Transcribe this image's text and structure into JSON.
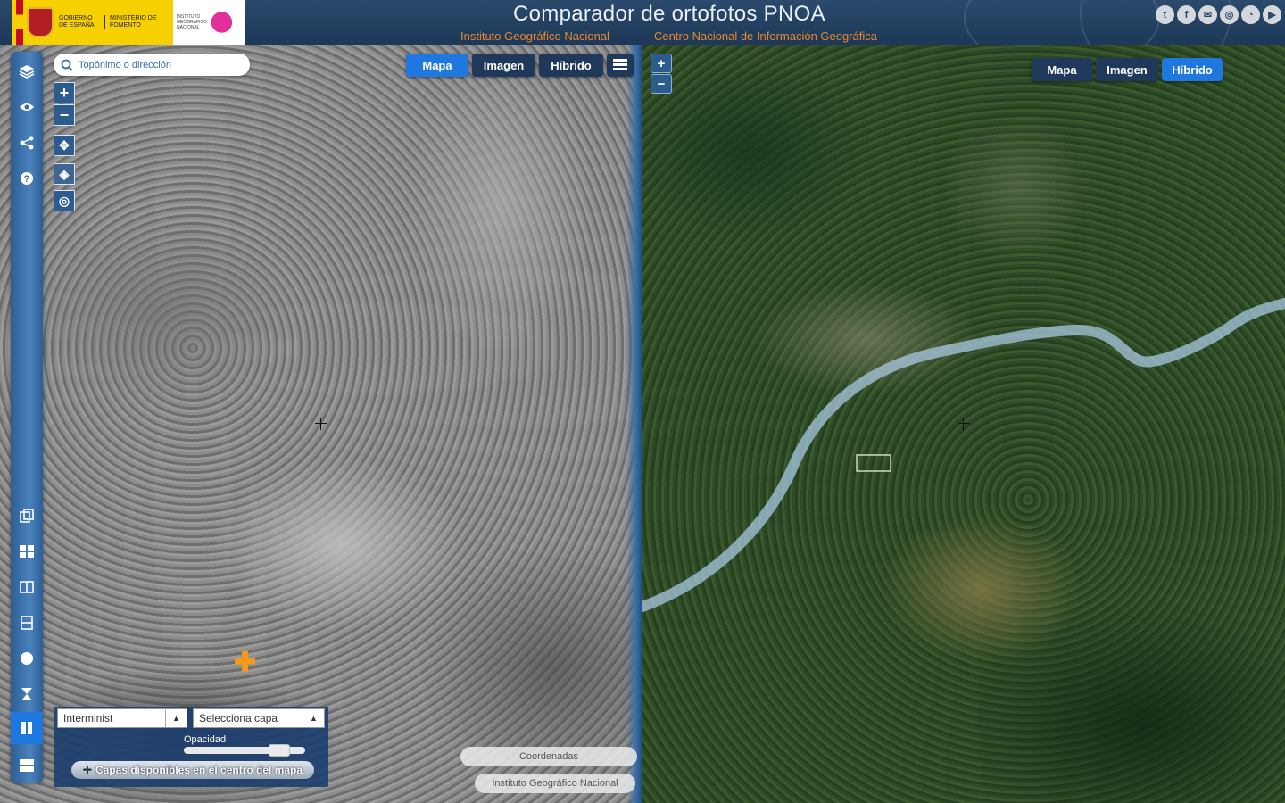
{
  "header": {
    "title": "Comparador de ortofotos PNOA",
    "subtitle_left": "Instituto Geográfico Nacional",
    "subtitle_right": "Centro Nacional de Información Geográfica",
    "logo_gov_text": "GOBIERNO DE ESPAÑA",
    "logo_ministry_text": "MINISTERIO DE FOMENTO",
    "logo_ign_text": "INSTITUTO GEOGRÁFICO NACIONAL",
    "social": [
      {
        "name": "twitter-icon",
        "glyph": "t"
      },
      {
        "name": "facebook-icon",
        "glyph": "f"
      },
      {
        "name": "email-icon",
        "glyph": "✉"
      },
      {
        "name": "instagram-icon",
        "glyph": "◎"
      },
      {
        "name": "rss-icon",
        "glyph": "◔"
      },
      {
        "name": "youtube-icon",
        "glyph": "▶"
      }
    ]
  },
  "colors": {
    "header_bg": "#2b4a6c",
    "accent_orange": "#e8892b",
    "active_blue": "#1f78e0",
    "button_dark": "#20395b"
  },
  "search": {
    "placeholder": "Topónimo o dirección"
  },
  "left_map": {
    "layer_buttons": {
      "map": "Mapa",
      "image": "Imagen",
      "hybrid": "Híbrido"
    },
    "active_layer": "map",
    "zoom_in": "+",
    "zoom_out": "−",
    "layer_select": "Interminist",
    "compare_select": "Selecciona capa",
    "opacity_label": "Opacidad",
    "opacity_value": 0.85,
    "capas_button": "Capas disponibles en el centro del mapa",
    "coords_button": "Coordenadas",
    "attribution": "Instituto Geográfico Nacional"
  },
  "right_map": {
    "layer_buttons": {
      "map": "Mapa",
      "image": "Imagen",
      "hybrid": "Híbrido"
    },
    "active_layer": "hybrid",
    "zoom_in": "+",
    "zoom_out": "−"
  },
  "sidebar_icons": [
    "layers-icon",
    "eye-icon",
    "share-icon",
    "help-icon",
    "copy-icon",
    "grid-icon",
    "split-vertical-icon",
    "split-horizontal-icon",
    "circle-icon",
    "hourglass-icon",
    "pause-compare-icon",
    "stack-icon"
  ]
}
